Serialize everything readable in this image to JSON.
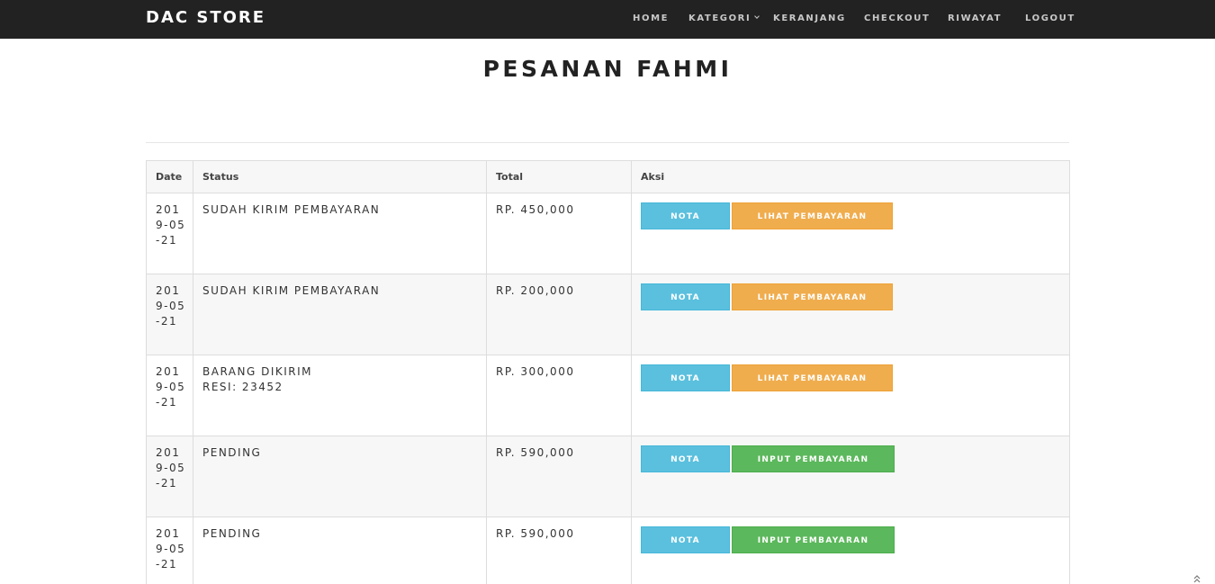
{
  "navbar": {
    "brand": "DAC STORE",
    "items": [
      {
        "label": "HOME"
      },
      {
        "label": "KATEGORI"
      },
      {
        "label": "KERANJANG"
      },
      {
        "label": "CHECKOUT"
      },
      {
        "label": "RIWAYAT"
      },
      {
        "label": "LOGOUT"
      }
    ]
  },
  "page": {
    "title": "PESANAN FAHMI"
  },
  "table": {
    "headers": [
      "Date",
      "Status",
      "Total",
      "Aksi"
    ],
    "rows": [
      {
        "date": "2019-05-21",
        "status": "SUDAH KIRIM PEMBAYARAN",
        "resi": "",
        "total": "RP. 450,000",
        "nota_label": "NOTA",
        "action_label": "LIHAT PEMBAYARAN",
        "action_type": "lihat"
      },
      {
        "date": "2019-05-21",
        "status": "SUDAH KIRIM PEMBAYARAN",
        "resi": "",
        "total": "RP. 200,000",
        "nota_label": "NOTA",
        "action_label": "LIHAT PEMBAYARAN",
        "action_type": "lihat"
      },
      {
        "date": "2019-05-21",
        "status": "BARANG DIKIRIM",
        "resi": "RESI: 23452",
        "total": "RP. 300,000",
        "nota_label": "NOTA",
        "action_label": "LIHAT PEMBAYARAN",
        "action_type": "lihat"
      },
      {
        "date": "2019-05-21",
        "status": "PENDING",
        "resi": "",
        "total": "RP. 590,000",
        "nota_label": "NOTA",
        "action_label": "INPUT PEMBAYARAN",
        "action_type": "input"
      },
      {
        "date": "2019-05-21",
        "status": "PENDING",
        "resi": "",
        "total": "RP. 590,000",
        "nota_label": "NOTA",
        "action_label": "INPUT PEMBAYARAN",
        "action_type": "input"
      }
    ]
  },
  "colors": {
    "navbar_bg": "#222222",
    "nota_button": "#5bc0de",
    "lihat_button": "#f0ad4e",
    "input_button": "#5cb85c"
  },
  "icons": {
    "scroll_top": "double-chevron-up-icon",
    "dropdown": "chevron-down-icon"
  }
}
